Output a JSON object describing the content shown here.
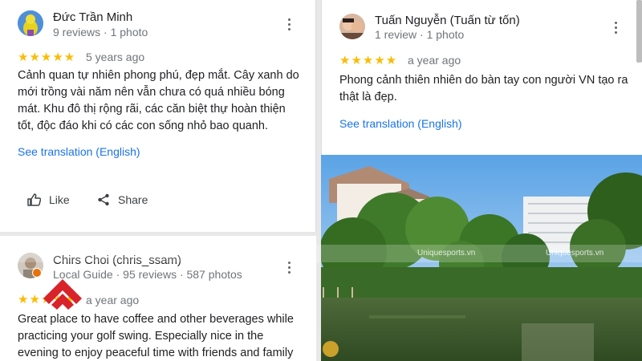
{
  "reviews": [
    {
      "name": "Đức Trần Minh",
      "meta": "9 reviews · 1 photo",
      "stars": "★★★★★",
      "rating": 5,
      "ago": "5 years ago",
      "text": "Cảnh quan tự nhiên phong phú, đẹp mắt. Cây xanh do mới trồng vài năm nên vẫn chưa có quá nhiều bóng mát. Khu đô thị rộng rãi, các căn biệt thự hoàn thiện tốt, độc đáo khi có các con sống nhỏ bao quanh.",
      "translate": "See translation (English)",
      "like": "Like",
      "share": "Share"
    },
    {
      "name": "Tuấn Nguyễn (Tuấn từ tốn)",
      "meta": "1 review · 1 photo",
      "stars": "★★★★★",
      "rating": 5,
      "ago": "a year ago",
      "text": "Phong cảnh thiên nhiên do bàn tay con người VN tạo ra thật là đẹp.",
      "translate": "See translation (English)"
    },
    {
      "name": "Chirs Choi (chris_ssam)",
      "meta": "Local Guide · 95 reviews · 587 photos",
      "stars": "★★★★★",
      "rating": 5,
      "ago": "a year ago",
      "text": "Great place to have coffee and other beverages while practicing your golf swing.  Especially nice in the evening to enjoy peaceful time with friends and family members."
    }
  ],
  "watermark": "Uniquesports.vn",
  "colors": {
    "star": "#fbbc04",
    "link": "#1a73e8",
    "text": "#202124",
    "meta": "#70757a",
    "logo_red": "#d8232a"
  }
}
